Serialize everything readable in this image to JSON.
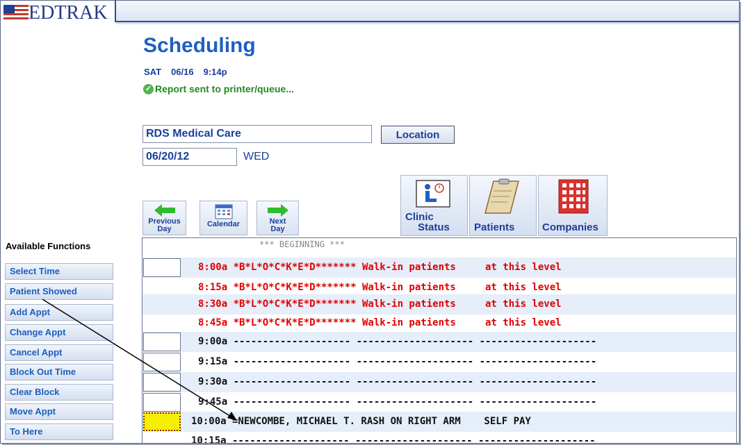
{
  "app": {
    "logo_text": "EDTRAK"
  },
  "header": {
    "title": "Scheduling",
    "day": "SAT",
    "date": "06/16",
    "time": "9:14p",
    "status_message": "Report sent to printer/queue..."
  },
  "location": {
    "value": "RDS Medical Care",
    "button_label": "Location"
  },
  "schedule_date": {
    "value": "06/20/12",
    "weekday": "WED"
  },
  "nav": {
    "previous": [
      "Previous",
      "Day"
    ],
    "calendar": "Calendar",
    "next": [
      "Next",
      "Day"
    ],
    "clinic_status": [
      "Clinic",
      "Status"
    ],
    "patients": "Patients",
    "companies": "Companies"
  },
  "functions": {
    "title": "Available Functions",
    "items": [
      {
        "label": "Select Time"
      },
      {
        "label": "Patient Showed"
      },
      {
        "label": "Add Appt"
      },
      {
        "label": "Change Appt"
      },
      {
        "label": "Cancel Appt"
      },
      {
        "label": "Block Out Time"
      },
      {
        "label": "Clear Block"
      },
      {
        "label": "Move Appt"
      },
      {
        "label": "To Here"
      }
    ]
  },
  "schedule": {
    "beginning_label": "*** BEGINNING ***",
    "rows": [
      {
        "text": "8:00a *B*L*O*C*K*E*D******* Walk-in patients     at this level",
        "type": "blocked"
      },
      {
        "text": "8:15a *B*L*O*C*K*E*D******* Walk-in patients     at this level",
        "type": "blocked"
      },
      {
        "text": "8:30a *B*L*O*C*K*E*D******* Walk-in patients     at this level",
        "type": "blocked"
      },
      {
        "text": "8:45a *B*L*O*C*K*E*D******* Walk-in patients     at this level",
        "type": "blocked"
      },
      {
        "text": "9:00a -------------------- -------------------- --------------------",
        "type": "open"
      },
      {
        "text": "9:15a -------------------- -------------------- --------------------",
        "type": "open"
      },
      {
        "text": "9:30a -------------------- -------------------- --------------------",
        "type": "open"
      },
      {
        "text": "9:45a -------------------- -------------------- --------------------",
        "type": "open"
      },
      {
        "text": "10:00a =NEWCOMBE, MICHAEL T. RASH ON RIGHT ARM    SELF PAY",
        "type": "appt",
        "selected": true
      },
      {
        "text": "10:15a -------------------- -------------------- --------------------",
        "type": "open"
      }
    ]
  },
  "colors": {
    "accent": "#1f5fbf",
    "blocked": "#e00000",
    "selected_slot": "#f4ef00",
    "status_ok": "#1f8a1f"
  }
}
